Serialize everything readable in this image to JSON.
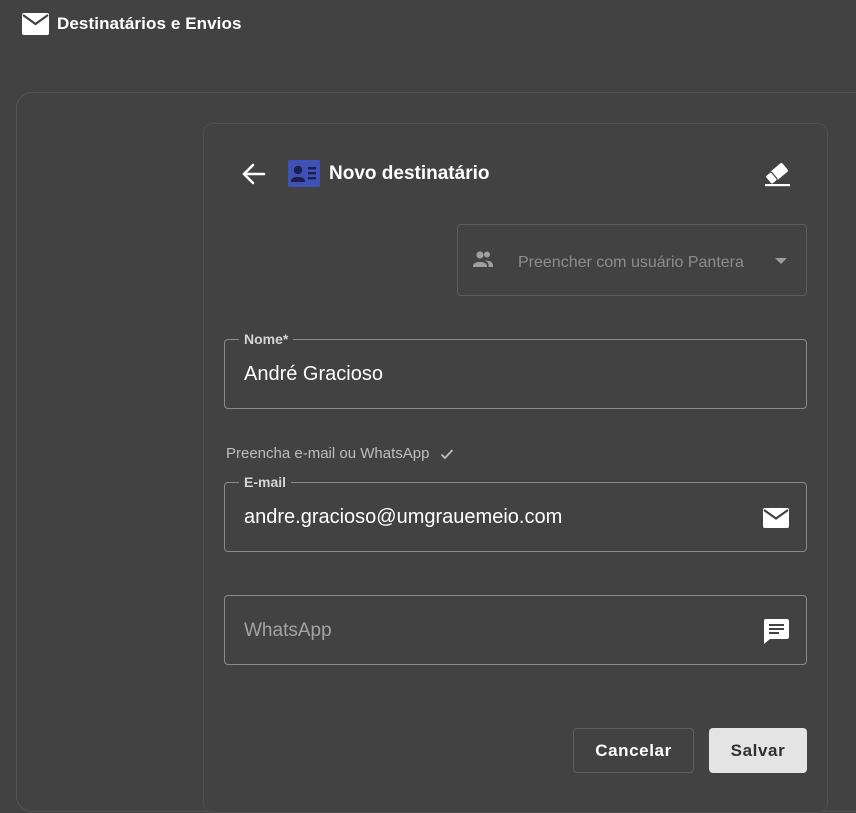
{
  "header": {
    "title": "Destinatários e Envios",
    "icon": "mail-icon"
  },
  "card": {
    "title": "Novo destinatário",
    "back_icon": "arrow-left-icon",
    "title_icon": "contact-card-icon",
    "clear_icon": "eraser-icon"
  },
  "user_select": {
    "placeholder": "Preencher com usuário Pantera",
    "icon": "people-icon"
  },
  "fields": {
    "name": {
      "label": "Nome*",
      "value": "André Gracioso"
    },
    "hint": "Preencha e-mail ou WhatsApp",
    "email": {
      "label": "E-mail",
      "value": "andre.gracioso@umgrauemeio.com",
      "icon": "mail-icon"
    },
    "whatsapp": {
      "placeholder": "WhatsApp",
      "icon": "message-icon"
    }
  },
  "actions": {
    "cancel_label": "Cancelar",
    "save_label": "Salvar"
  },
  "colors": {
    "background": "#424242",
    "accent_icon": "#3f51b5",
    "save_button": "#e4e4e4"
  }
}
